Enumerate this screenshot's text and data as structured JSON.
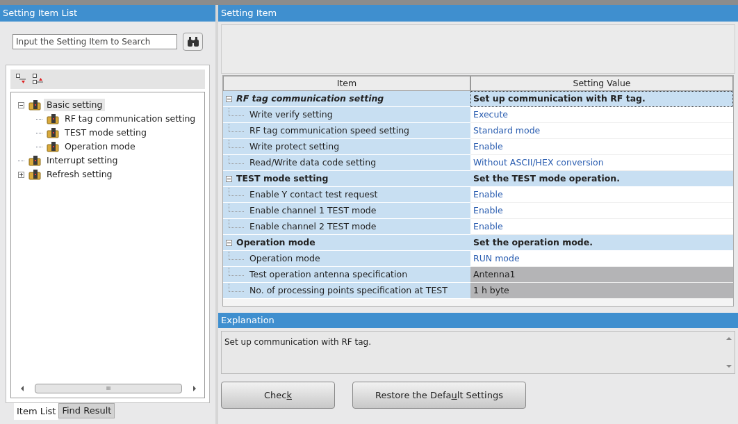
{
  "left_panel": {
    "title": "Setting Item List",
    "search": {
      "placeholder": "Input the Setting Item to Search"
    },
    "tree": [
      {
        "label": "Basic setting",
        "selected": true,
        "expanded": true,
        "children": [
          {
            "label": "RF tag communication setting",
            "selected": false
          },
          {
            "label": "TEST mode setting",
            "selected": false
          },
          {
            "label": "Operation mode",
            "selected": false
          }
        ]
      },
      {
        "label": "Interrupt setting",
        "selected": false
      },
      {
        "label": "Refresh setting",
        "selected": false,
        "expanded": false
      }
    ],
    "scrollbar_grip": "III",
    "tabs": [
      {
        "label": "Item List",
        "selected": true
      },
      {
        "label": "Find Result",
        "selected": false
      }
    ]
  },
  "right_panel": {
    "title": "Setting Item",
    "table": {
      "columns": [
        "Item",
        "Setting Value"
      ],
      "groups": [
        {
          "label": "RF tag communication setting",
          "italic": true,
          "expanded": true,
          "value": "Set up communication with RF tag.",
          "focused": true,
          "rows": [
            {
              "label": "Write verify setting",
              "value": "Execute",
              "disabled": false
            },
            {
              "label": "RF tag communication speed setting",
              "value": "Standard mode",
              "disabled": false
            },
            {
              "label": "Write protect setting",
              "value": "Enable",
              "disabled": false
            },
            {
              "label": "Read/Write data code setting",
              "value": "Without ASCII/HEX conversion",
              "disabled": false
            }
          ]
        },
        {
          "label": "TEST mode setting",
          "italic": false,
          "expanded": true,
          "value": "Set the TEST mode operation.",
          "focused": false,
          "rows": [
            {
              "label": "Enable Y contact test request",
              "value": "Enable",
              "disabled": false
            },
            {
              "label": "Enable channel 1 TEST mode",
              "value": "Enable",
              "disabled": false
            },
            {
              "label": "Enable channel 2 TEST mode",
              "value": "Enable",
              "disabled": false
            }
          ]
        },
        {
          "label": "Operation mode",
          "italic": false,
          "expanded": true,
          "value": "Set the operation mode.",
          "focused": false,
          "rows": [
            {
              "label": "Operation mode",
              "value": "RUN mode",
              "disabled": false
            },
            {
              "label": "Test operation antenna specification",
              "value": "Antenna1",
              "disabled": true
            },
            {
              "label": "No. of processing points specification at TEST",
              "value": "1 h byte",
              "disabled": true
            }
          ]
        }
      ]
    },
    "explanation": {
      "title": "Explanation",
      "text": "Set up communication with RF tag."
    },
    "buttons": [
      {
        "label_parts": [
          "Chec",
          "k"
        ]
      },
      {
        "label_parts": [
          "Restore the Defa",
          "u",
          "lt Settings"
        ]
      }
    ]
  }
}
